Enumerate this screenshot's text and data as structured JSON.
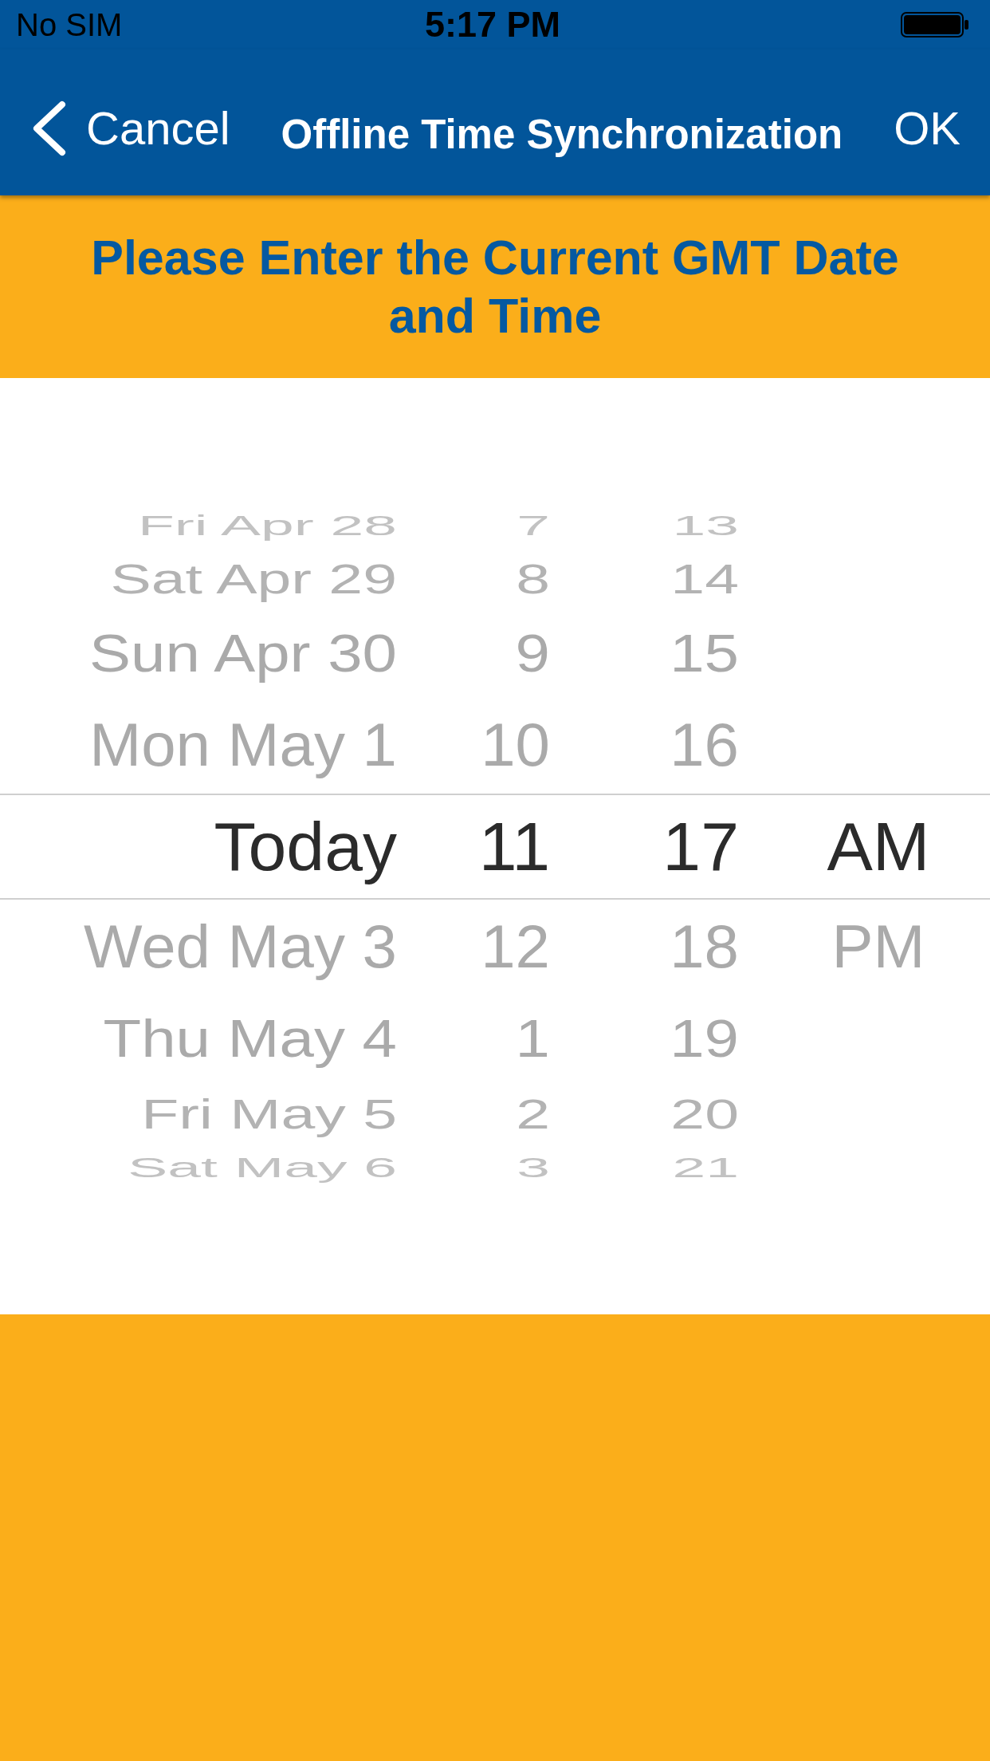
{
  "status_bar": {
    "carrier": "No SIM",
    "time": "5:17 PM"
  },
  "nav_bar": {
    "back_label": "Cancel",
    "title": "Offline Time Synchronization",
    "confirm_label": "OK"
  },
  "banner": {
    "text": "Please Enter the Current GMT Date and Time"
  },
  "picker": {
    "columns": [
      {
        "kind": "date",
        "items": [
          {
            "label": "Fri Apr 28",
            "selected": false
          },
          {
            "label": "Sat Apr 29",
            "selected": false
          },
          {
            "label": "Sun Apr 30",
            "selected": false
          },
          {
            "label": "Mon May 1",
            "selected": false
          },
          {
            "label": "Today",
            "selected": true
          },
          {
            "label": "Wed May 3",
            "selected": false
          },
          {
            "label": "Thu May 4",
            "selected": false
          },
          {
            "label": "Fri May 5",
            "selected": false
          },
          {
            "label": "Sat May 6",
            "selected": false
          }
        ]
      },
      {
        "kind": "hour",
        "items": [
          {
            "label": "7",
            "selected": false
          },
          {
            "label": "8",
            "selected": false
          },
          {
            "label": "9",
            "selected": false
          },
          {
            "label": "10",
            "selected": false
          },
          {
            "label": "11",
            "selected": true
          },
          {
            "label": "12",
            "selected": false
          },
          {
            "label": "1",
            "selected": false
          },
          {
            "label": "2",
            "selected": false
          },
          {
            "label": "3",
            "selected": false
          }
        ]
      },
      {
        "kind": "minute",
        "items": [
          {
            "label": "13",
            "selected": false
          },
          {
            "label": "14",
            "selected": false
          },
          {
            "label": "15",
            "selected": false
          },
          {
            "label": "16",
            "selected": false
          },
          {
            "label": "17",
            "selected": true
          },
          {
            "label": "18",
            "selected": false
          },
          {
            "label": "19",
            "selected": false
          },
          {
            "label": "20",
            "selected": false
          },
          {
            "label": "21",
            "selected": false
          }
        ]
      },
      {
        "kind": "period",
        "items": [
          {
            "label": "AM",
            "selected": true
          },
          {
            "label": "PM",
            "selected": false
          }
        ]
      }
    ]
  }
}
